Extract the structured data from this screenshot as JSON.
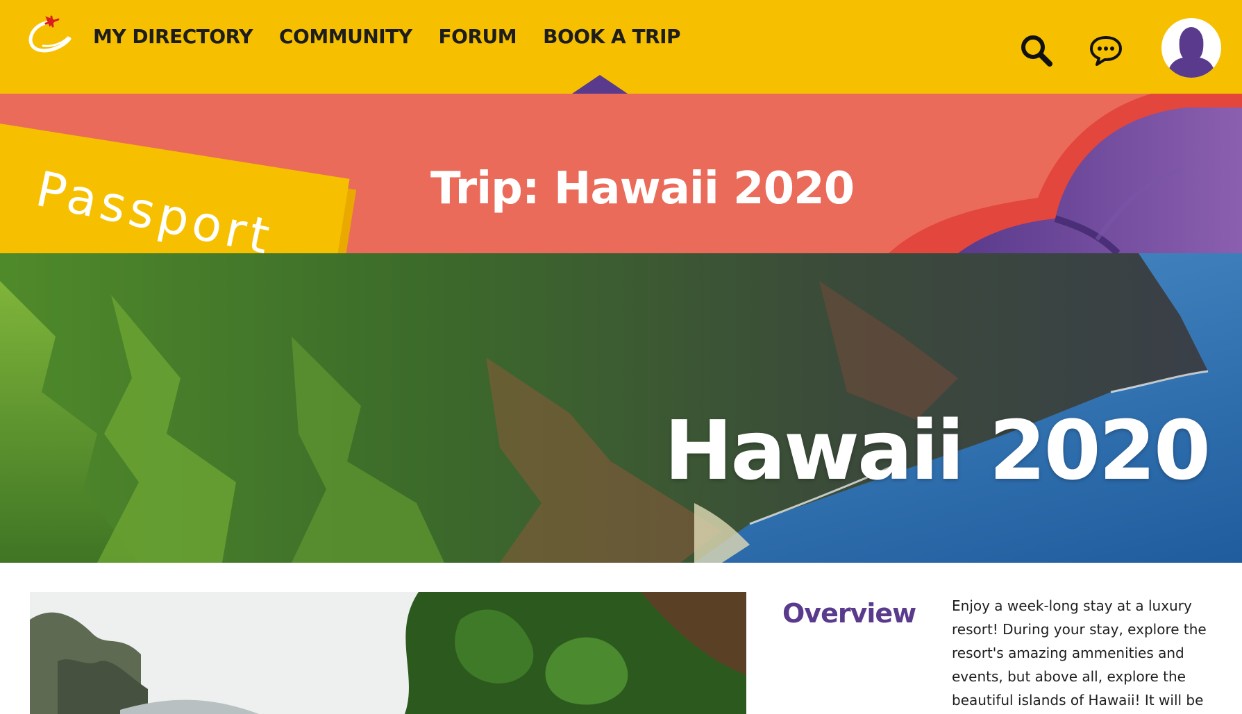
{
  "nav": {
    "logo_icon": "plane-swoosh-logo",
    "links": [
      "MY DIRECTORY",
      "COMMUNITY",
      "FORUM",
      "BOOK A TRIP"
    ],
    "active_link": "BOOK A TRIP",
    "icons": [
      "search-icon",
      "chat-icon",
      "user-avatar-icon"
    ]
  },
  "banner": {
    "stamp_label": "Passport",
    "title": "Trip: Hawaii 2020"
  },
  "hero": {
    "title": "Hawaii 2020"
  },
  "overview": {
    "heading": "Overview",
    "body": "Enjoy a week-long stay at a luxury resort! During your stay, explore the resort's amazing ammenities and events, but above all, explore the beautiful islands of Hawaii! It will be a trip for you"
  },
  "colors": {
    "nav_bg": "#f6c000",
    "banner_bg": "#ea6b5a",
    "accent_purple": "#5a3a8c",
    "text_dark": "#1d1d1d"
  }
}
